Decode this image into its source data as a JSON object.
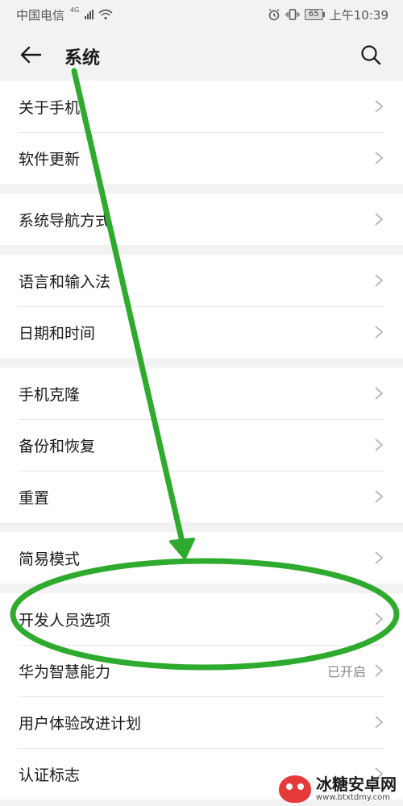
{
  "status_bar": {
    "carrier": "中国电信",
    "network": "4G",
    "time": "上午10:39",
    "battery": "65"
  },
  "header": {
    "title": "系统"
  },
  "groups": [
    {
      "items": [
        {
          "label": "关于手机"
        },
        {
          "label": "软件更新"
        }
      ]
    },
    {
      "items": [
        {
          "label": "系统导航方式"
        }
      ]
    },
    {
      "items": [
        {
          "label": "语言和输入法"
        },
        {
          "label": "日期和时间"
        }
      ]
    },
    {
      "items": [
        {
          "label": "手机克隆"
        },
        {
          "label": "备份和恢复"
        },
        {
          "label": "重置"
        }
      ]
    },
    {
      "items": [
        {
          "label": "简易模式"
        }
      ]
    },
    {
      "items": [
        {
          "label": "开发人员选项"
        },
        {
          "label": "华为智慧能力",
          "value": "已开启"
        },
        {
          "label": "用户体验改进计划"
        },
        {
          "label": "认证标志"
        }
      ]
    }
  ],
  "annotation": {
    "color": "#2eaa2e"
  },
  "watermark": {
    "title": "冰糖安卓网",
    "url": "www.btxtdmy.com"
  }
}
